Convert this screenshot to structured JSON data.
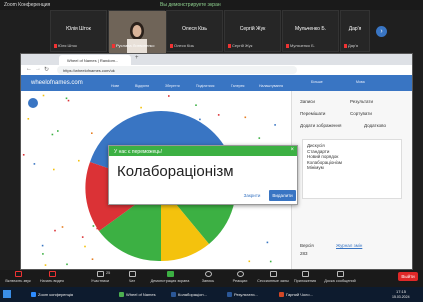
{
  "zoom": {
    "title": "Zoom Конференция",
    "share_banner": "Вы демонстрируете экран",
    "tiles": [
      {
        "name": "Юлія Шток",
        "sub": "Юля Шток"
      },
      {
        "name": "",
        "sub": "Руслана Литвиненко"
      },
      {
        "name": "Олеся Кізь",
        "sub": "Олеся Кізь"
      },
      {
        "name": "Сергій Жук",
        "sub": "Сергій Жук"
      },
      {
        "name": "Мульченко Б.",
        "sub": "Мульченко Б."
      },
      {
        "name": "Дар'я",
        "sub": "Дар'я"
      }
    ],
    "toolbar": [
      {
        "label": "Включить звук"
      },
      {
        "label": "Начать видео"
      },
      {
        "label": "Участники"
      },
      {
        "label": "Чат"
      },
      {
        "label": "Демонстрация экрана"
      },
      {
        "label": "Запись"
      },
      {
        "label": "Реакции"
      },
      {
        "label": "Сессионные залы"
      },
      {
        "label": "Приложения"
      },
      {
        "label": "Доска сообщений"
      }
    ],
    "participants_count": "25",
    "end_label": "Выйти"
  },
  "browser": {
    "tab_title": "Wheel of Names | Random...",
    "url": "https://wheelofnames.com/uk",
    "site_brand": "wheelofnames.com",
    "menu": [
      "Нове",
      "Відкрити",
      "Зберегти",
      "Поділитися",
      "Галерея",
      "Налаштування",
      "Більше",
      "Мова"
    ]
  },
  "panel": {
    "entries_label": "Записи",
    "results_label": "Результати",
    "hide_label": "Сховати",
    "shuffle_label": "Перемішати",
    "sort_label": "Сортувати",
    "add_image_label": "Додати зображення",
    "advanced_label": "Додатково",
    "entries": [
      "Дискусія",
      "Стандарти",
      "Новий порядок",
      "Колабораціонізм",
      "Мінімум"
    ],
    "version_label": "Версія",
    "version_value": "283",
    "changelog_label": "Журнал змін"
  },
  "modal": {
    "header": "У нас є переможець!",
    "winner": "Колабораціонізм",
    "close_label": "Закрити",
    "remove_label": "Видалити"
  },
  "taskbar": {
    "items": [
      "Zoom конференція",
      "Wheel of Names",
      "Колабораціон...",
      "Результати...",
      "Гарний Чоло..."
    ],
    "time": "17:15",
    "date": "15.03.2024"
  },
  "colors": {
    "zoom_bg": "#1a1a1a",
    "wheel_blue": "#3975c3",
    "modal_green": "#3cb043",
    "wheel_red": "#db3236",
    "wheel_yellow": "#f4c20d",
    "end_red": "#e02828"
  }
}
